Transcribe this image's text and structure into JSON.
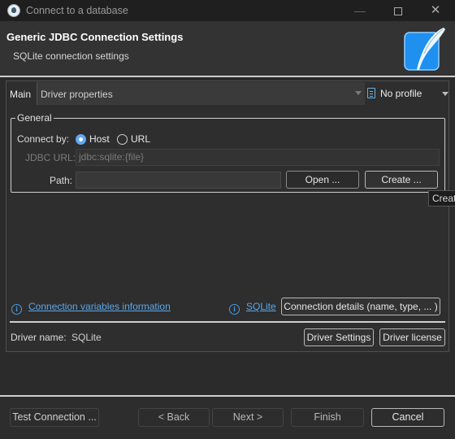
{
  "window": {
    "title": "Connect to a database",
    "minimize_glyph": "—",
    "close_glyph": "✕"
  },
  "header": {
    "title": "Generic JDBC Connection Settings",
    "subtitle": "SQLite connection settings",
    "logo_icon": "sqlite-feather-icon",
    "logo_color": "#1f8ff0"
  },
  "tabs": {
    "main_label": "Main",
    "driver_properties_label": "Driver properties",
    "profile_label": "No profile"
  },
  "general": {
    "legend": "General",
    "connect_by_label": "Connect by:",
    "host_option": "Host",
    "url_option": "URL",
    "selected": "Host",
    "jdbc_url_label": "JDBC URL:",
    "jdbc_url_value": "jdbc:sqlite:{file}",
    "path_label": "Path:",
    "path_value": "",
    "open_button": "Open ...",
    "create_button": "Create ..."
  },
  "tooltip": {
    "text": "Creat"
  },
  "info": {
    "variables_link": "Connection variables information",
    "sqlite_link": "SQLite",
    "connection_details_button": "Connection details (name, type, ... )",
    "info_glyph": "i"
  },
  "driver": {
    "name_label": "Driver name:",
    "name_value": "SQLite",
    "settings_button": "Driver Settings",
    "license_button": "Driver license"
  },
  "footer": {
    "test_connection": "Test Connection ...",
    "back": "< Back",
    "next": "Next >",
    "finish": "Finish",
    "cancel": "Cancel"
  },
  "colors": {
    "accent": "#5fa8f0",
    "link": "#5aa7ea"
  }
}
